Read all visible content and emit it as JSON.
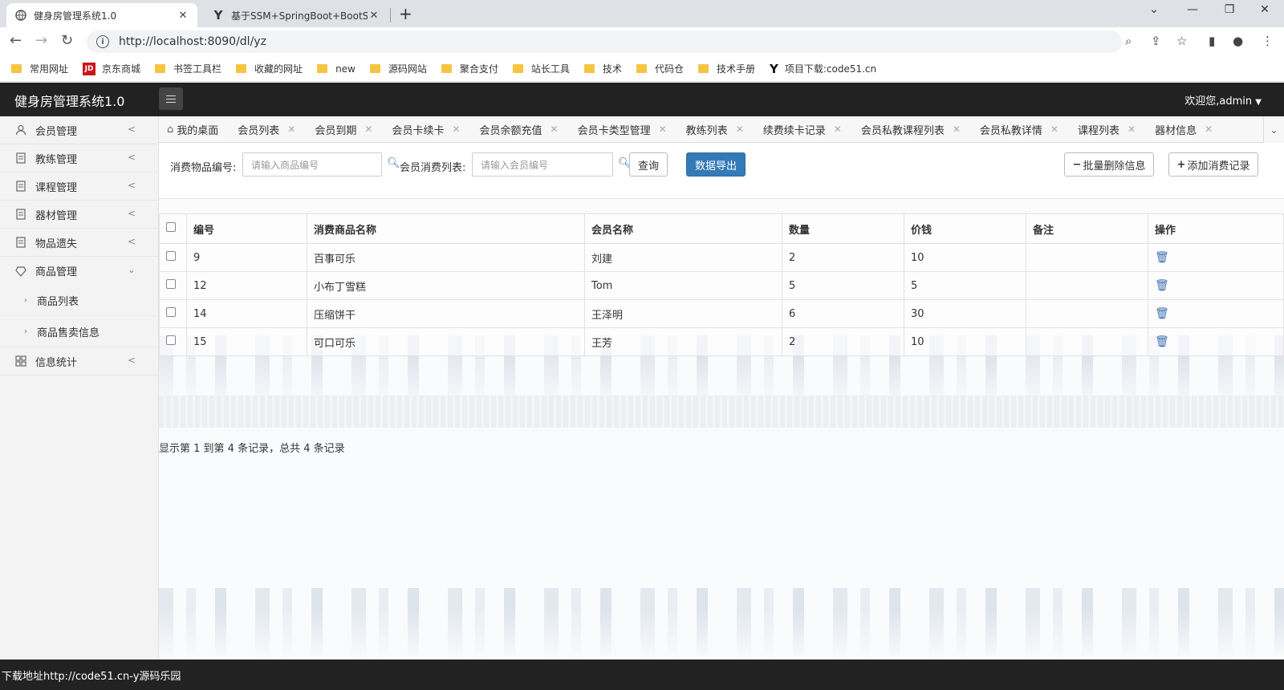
{
  "browser": {
    "tabs": [
      {
        "title": "健身房管理系统1.0",
        "active": true
      },
      {
        "title": "基于SSM+SpringBoot+BootSt",
        "active": false
      }
    ],
    "url": "http://localhost:8090/dl/yz",
    "bookmarks": [
      "常用网址",
      "京东商城",
      "书签工具栏",
      "收藏的网址",
      "new",
      "源码网站",
      "聚合支付",
      "站长工具",
      "技术",
      "代码仓",
      "技术手册",
      "项目下载:code51.cn"
    ]
  },
  "app": {
    "title": "健身房管理系统1.0",
    "welcome": "欢迎您,admin"
  },
  "sidebar": {
    "items": [
      {
        "label": "会员管理",
        "icon": "user-icon"
      },
      {
        "label": "教练管理",
        "icon": "document-icon"
      },
      {
        "label": "课程管理",
        "icon": "document-icon"
      },
      {
        "label": "器材管理",
        "icon": "document-icon"
      },
      {
        "label": "物品遗失",
        "icon": "document-icon"
      },
      {
        "label": "商品管理",
        "icon": "gem-icon"
      }
    ],
    "subitems": [
      "商品列表",
      "商品售卖信息"
    ],
    "last": {
      "label": "信息统计",
      "icon": "grid-icon"
    }
  },
  "pagetabs": [
    "我的桌面",
    "会员列表",
    "会员到期",
    "会员卡续卡",
    "会员余额充值",
    "会员卡类型管理",
    "教练列表",
    "续费续卡记录",
    "会员私教课程列表",
    "会员私教详情",
    "课程列表",
    "器材信息"
  ],
  "search": {
    "label1": "消费物品编号:",
    "placeholder1": "请输入商品编号",
    "label2": "会员消费列表:",
    "placeholder2": "请输入会员编号",
    "query": "查询",
    "export": "数据导出",
    "batch_delete": "批量删除信息",
    "add": "添加消费记录"
  },
  "table": {
    "headers": [
      "编号",
      "消费商品名称",
      "会员名称",
      "数量",
      "价钱",
      "备注",
      "操作"
    ],
    "rows": [
      {
        "id": "9",
        "goods": "百事可乐",
        "member": "刘建",
        "qty": "2",
        "price": "10",
        "note": ""
      },
      {
        "id": "12",
        "goods": "小布丁雪糕",
        "member": "Tom",
        "qty": "5",
        "price": "5",
        "note": ""
      },
      {
        "id": "14",
        "goods": "压缩饼干",
        "member": "王泽明",
        "qty": "6",
        "price": "30",
        "note": ""
      },
      {
        "id": "15",
        "goods": "可口可乐",
        "member": "王芳",
        "qty": "2",
        "price": "10",
        "note": ""
      }
    ]
  },
  "pager": "显示第 1 到第 4 条记录，总共 4 条记录",
  "status": "下载地址http://code51.cn-y源码乐园"
}
